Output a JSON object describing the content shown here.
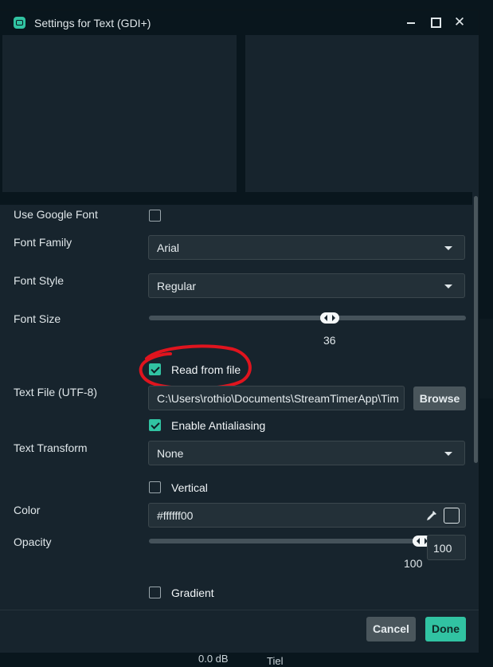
{
  "window": {
    "title": "Settings for Text (GDI+)"
  },
  "background": {
    "db_text": "0.0 dB",
    "side_text": "Tiel"
  },
  "form": {
    "use_google_font": {
      "label": "Use Google Font",
      "checked": false
    },
    "font_family": {
      "label": "Font Family",
      "value": "Arial"
    },
    "font_style": {
      "label": "Font Style",
      "value": "Regular"
    },
    "font_size": {
      "label": "Font Size",
      "value": "36",
      "level": 0.57
    },
    "read_from_file": {
      "label": "Read from file",
      "checked": true
    },
    "text_file": {
      "label": "Text File (UTF-8)",
      "value": "C:\\Users\\rothio\\Documents\\StreamTimerApp\\Tim",
      "browse_label": "Browse"
    },
    "antialiasing": {
      "label": "Enable Antialiasing",
      "checked": true
    },
    "text_transform": {
      "label": "Text Transform",
      "value": "None"
    },
    "vertical": {
      "label": "Vertical",
      "checked": false
    },
    "color": {
      "label": "Color",
      "value": "#ffffff00"
    },
    "opacity": {
      "label": "Opacity",
      "value": "100",
      "level": 1.0
    },
    "gradient": {
      "label": "Gradient",
      "checked": false
    }
  },
  "footer": {
    "cancel_label": "Cancel",
    "done_label": "Done"
  },
  "colors": {
    "accent": "#31c3a2",
    "panel": "#17242d",
    "input": "#233038",
    "annotation": "#e0141e"
  },
  "icons": [
    "streamlabs-app-icon",
    "minimize-icon",
    "maximize-icon",
    "close-icon",
    "chevron-down-icon",
    "eyedropper-icon",
    "color-swatch-icon"
  ]
}
